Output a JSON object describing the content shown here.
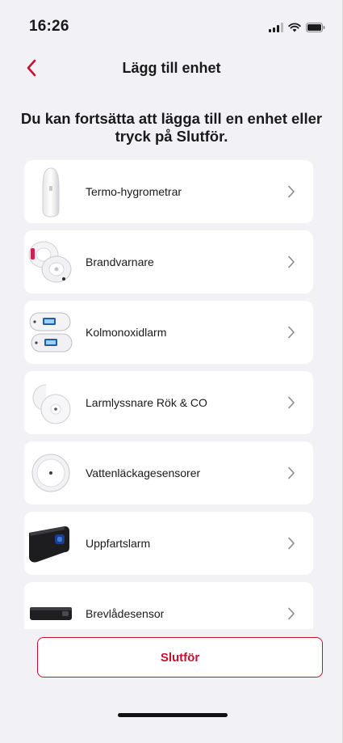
{
  "status_bar": {
    "time": "16:26",
    "icons": [
      "cellular-signal-icon",
      "wifi-icon",
      "battery-icon"
    ]
  },
  "nav": {
    "title": "Lägg till enhet",
    "back_icon": "chevron-left-icon"
  },
  "intro_text": "Du kan fortsätta att lägga till en enhet eller tryck på Slutför.",
  "devices": [
    {
      "label": "Termo-hygrometrar",
      "icon": "thermo-hygrometer-icon"
    },
    {
      "label": "Brandvarnare",
      "icon": "smoke-alarm-icon"
    },
    {
      "label": "Kolmonoxidlarm",
      "icon": "co-alarm-icon"
    },
    {
      "label": "Larmlyssnare Rök & CO",
      "icon": "alarm-listener-icon"
    },
    {
      "label": "Vattenläckagesensorer",
      "icon": "water-leak-sensor-icon"
    },
    {
      "label": "Uppfartslarm",
      "icon": "driveway-alarm-icon"
    },
    {
      "label": "Brevlådesensor",
      "icon": "mailbox-sensor-icon"
    }
  ],
  "finish_button": {
    "label": "Slutför"
  },
  "colors": {
    "accent": "#c8102e",
    "background": "#f2f1f6",
    "card": "#ffffff"
  }
}
